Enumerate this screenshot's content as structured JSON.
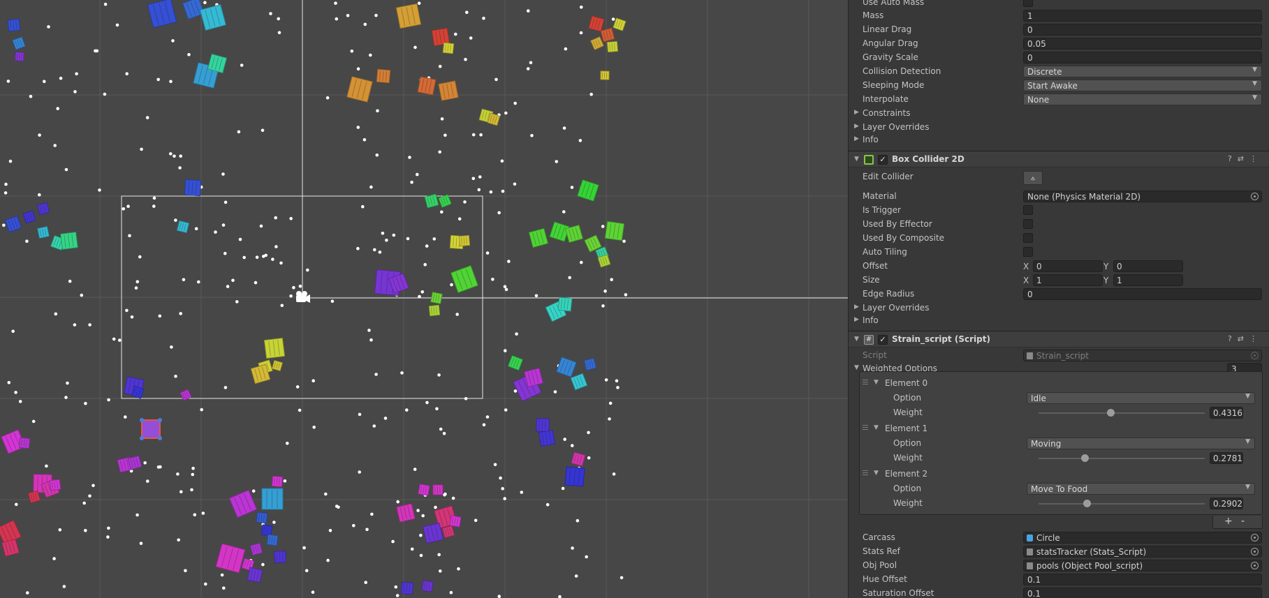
{
  "colors": {
    "scene_bg": "#474747",
    "inspector_bg": "#383838",
    "field_bg": "#2a2a2a",
    "accent_green": "#8bc34a"
  },
  "inspector": {
    "rigidbody": {
      "use_auto_mass": "Use Auto Mass",
      "mass_label": "Mass",
      "mass": "1",
      "linear_drag_label": "Linear Drag",
      "linear_drag": "0",
      "angular_drag_label": "Angular Drag",
      "angular_drag": "0.05",
      "gravity_scale_label": "Gravity Scale",
      "gravity_scale": "0",
      "collision_detection_label": "Collision Detection",
      "collision_detection": "Discrete",
      "sleeping_mode_label": "Sleeping Mode",
      "sleeping_mode": "Start Awake",
      "interpolate_label": "Interpolate",
      "interpolate": "None",
      "constraints_label": "Constraints",
      "layer_overrides_label": "Layer Overrides",
      "info_label": "Info"
    },
    "box_collider": {
      "title": "Box Collider 2D",
      "edit_collider_label": "Edit Collider",
      "material_label": "Material",
      "material": "None (Physics Material 2D)",
      "is_trigger_label": "Is Trigger",
      "used_by_effector_label": "Used By Effector",
      "used_by_composite_label": "Used By Composite",
      "auto_tiling_label": "Auto Tiling",
      "offset_label": "Offset",
      "offset_x": "0",
      "offset_y": "0",
      "size_label": "Size",
      "size_x": "1",
      "size_y": "1",
      "edge_radius_label": "Edge Radius",
      "edge_radius": "0",
      "layer_overrides_label": "Layer Overrides",
      "info_label": "Info",
      "x_label": "X",
      "y_label": "Y"
    },
    "strain_script": {
      "title": "Strain_script (Script)",
      "script_label": "Script",
      "script": "Strain_script",
      "weighted_options_label": "Weighted Options",
      "weighted_options_count": "3",
      "option_label": "Option",
      "weight_label": "Weight",
      "elements": [
        {
          "name": "Element 0",
          "option": "Idle",
          "weight": "0.43160",
          "weight_value": 0.4316
        },
        {
          "name": "Element 1",
          "option": "Moving",
          "weight": "0.27811",
          "weight_value": 0.27811
        },
        {
          "name": "Element 2",
          "option": "Move To Food",
          "weight": "0.29028",
          "weight_value": 0.29028
        }
      ],
      "add_label": "+",
      "remove_label": "-",
      "carcass_label": "Carcass",
      "carcass": "Circle",
      "stats_ref_label": "Stats Ref",
      "stats_ref": "statsTracker (Stats_Script)",
      "obj_pool_label": "Obj Pool",
      "obj_pool": "pools (Object Pool_script)",
      "hue_offset_label": "Hue Offset",
      "hue_offset": "0.1",
      "saturation_offset_label": "Saturation Offset",
      "saturation_offset": "0.1"
    }
  }
}
